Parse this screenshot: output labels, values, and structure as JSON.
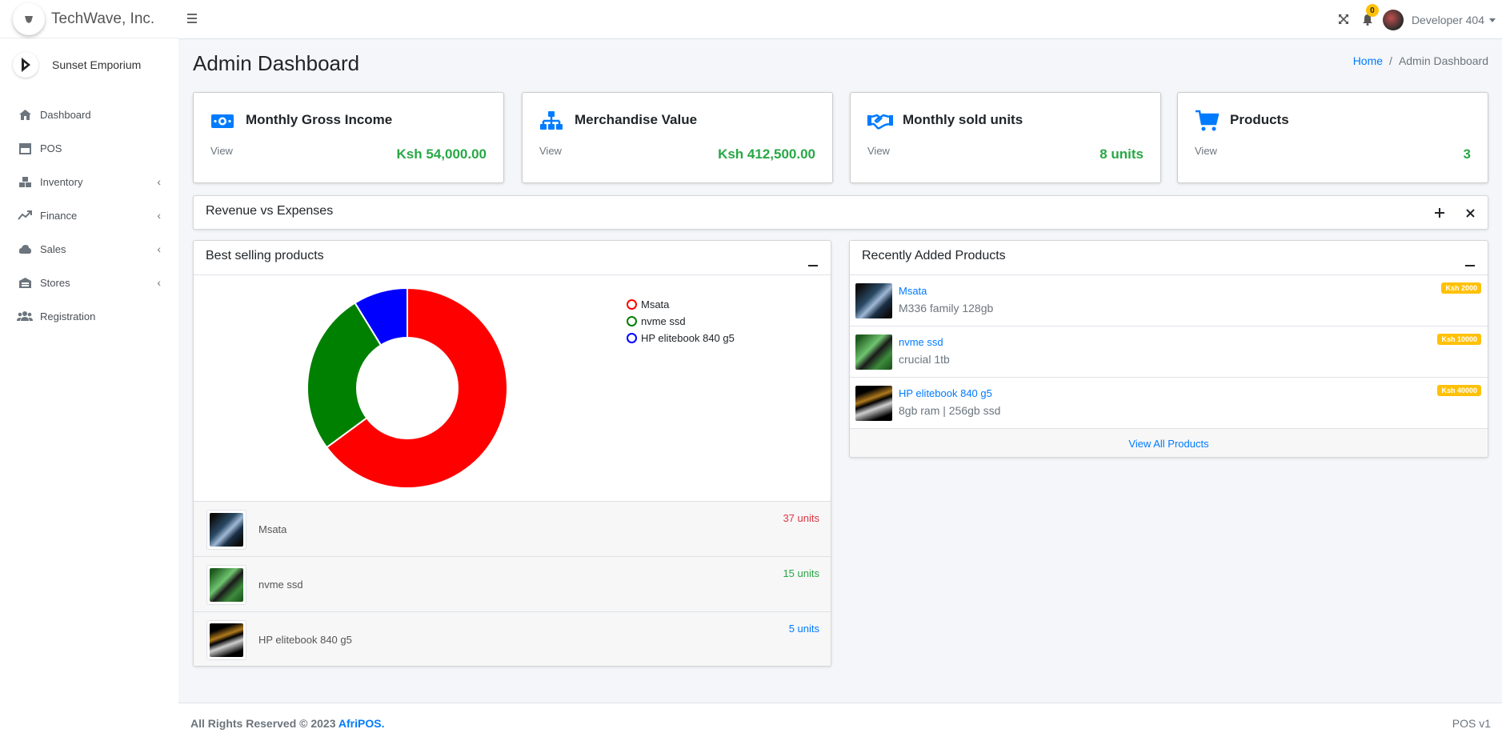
{
  "brand": {
    "company": "TechWave, Inc.",
    "store": "Sunset Emporium"
  },
  "sidebar": {
    "items": [
      {
        "label": "Dashboard",
        "icon": "home-icon",
        "has_submenu": false
      },
      {
        "label": "POS",
        "icon": "store-icon",
        "has_submenu": false
      },
      {
        "label": "Inventory",
        "icon": "boxes-icon",
        "has_submenu": true
      },
      {
        "label": "Finance",
        "icon": "trend-up-icon",
        "has_submenu": true
      },
      {
        "label": "Sales",
        "icon": "cloud-chart-icon",
        "has_submenu": true
      },
      {
        "label": "Stores",
        "icon": "warehouse-icon",
        "has_submenu": true
      },
      {
        "label": "Registration",
        "icon": "users-icon",
        "has_submenu": false
      }
    ]
  },
  "topbar": {
    "notifications_count": "0",
    "user_name": "Developer 404"
  },
  "header": {
    "title": "Admin Dashboard",
    "breadcrumb": {
      "home": "Home",
      "separator": "/",
      "current": "Admin Dashboard"
    }
  },
  "info_boxes": [
    {
      "title": "Monthly Gross Income",
      "link": "View",
      "value": "Ksh 54,000.00",
      "icon": "money-icon"
    },
    {
      "title": "Merchandise Value",
      "link": "View",
      "value": "Ksh 412,500.00",
      "icon": "sitemap-icon"
    },
    {
      "title": "Monthly sold units",
      "link": "View",
      "value": "8 units",
      "icon": "handshake-icon"
    },
    {
      "title": "Products",
      "link": "View",
      "value": "3",
      "icon": "cart-icon"
    }
  ],
  "revenue_card": {
    "title": "Revenue vs Expenses"
  },
  "best_selling": {
    "title": "Best selling products",
    "rows": [
      {
        "name": "Msata",
        "units": "37 units",
        "color": "#dc3545"
      },
      {
        "name": "nvme ssd",
        "units": "15 units",
        "color": "#28a745"
      },
      {
        "name": "HP elitebook 840 g5",
        "units": "5 units",
        "color": "#007bff"
      }
    ]
  },
  "chart_data": {
    "type": "pie",
    "donut": true,
    "labels": [
      "Msata",
      "nvme ssd",
      "HP elitebook 840 g5"
    ],
    "values": [
      37,
      15,
      5
    ],
    "colors": [
      "#ff0000",
      "#008000",
      "#0000ff"
    ],
    "legend_position": "top-right"
  },
  "recent_products": {
    "title": "Recently Added Products",
    "items": [
      {
        "name": "Msata",
        "description": "M336 family 128gb",
        "price": "Ksh 2000"
      },
      {
        "name": "nvme ssd",
        "description": "crucial 1tb",
        "price": "Ksh 10000"
      },
      {
        "name": "HP elitebook 840 g5",
        "description": "8gb ram | 256gb ssd",
        "price": "Ksh 40000"
      }
    ],
    "footer_link": "View All Products"
  },
  "footer": {
    "left_text": "All Rights Reserved © 2023",
    "brand_link": "AfriPOS.",
    "version": "POS v1"
  },
  "colors": {
    "accent": "#007bff",
    "success": "#28a745",
    "warning": "#ffc107",
    "danger": "#dc3545"
  }
}
